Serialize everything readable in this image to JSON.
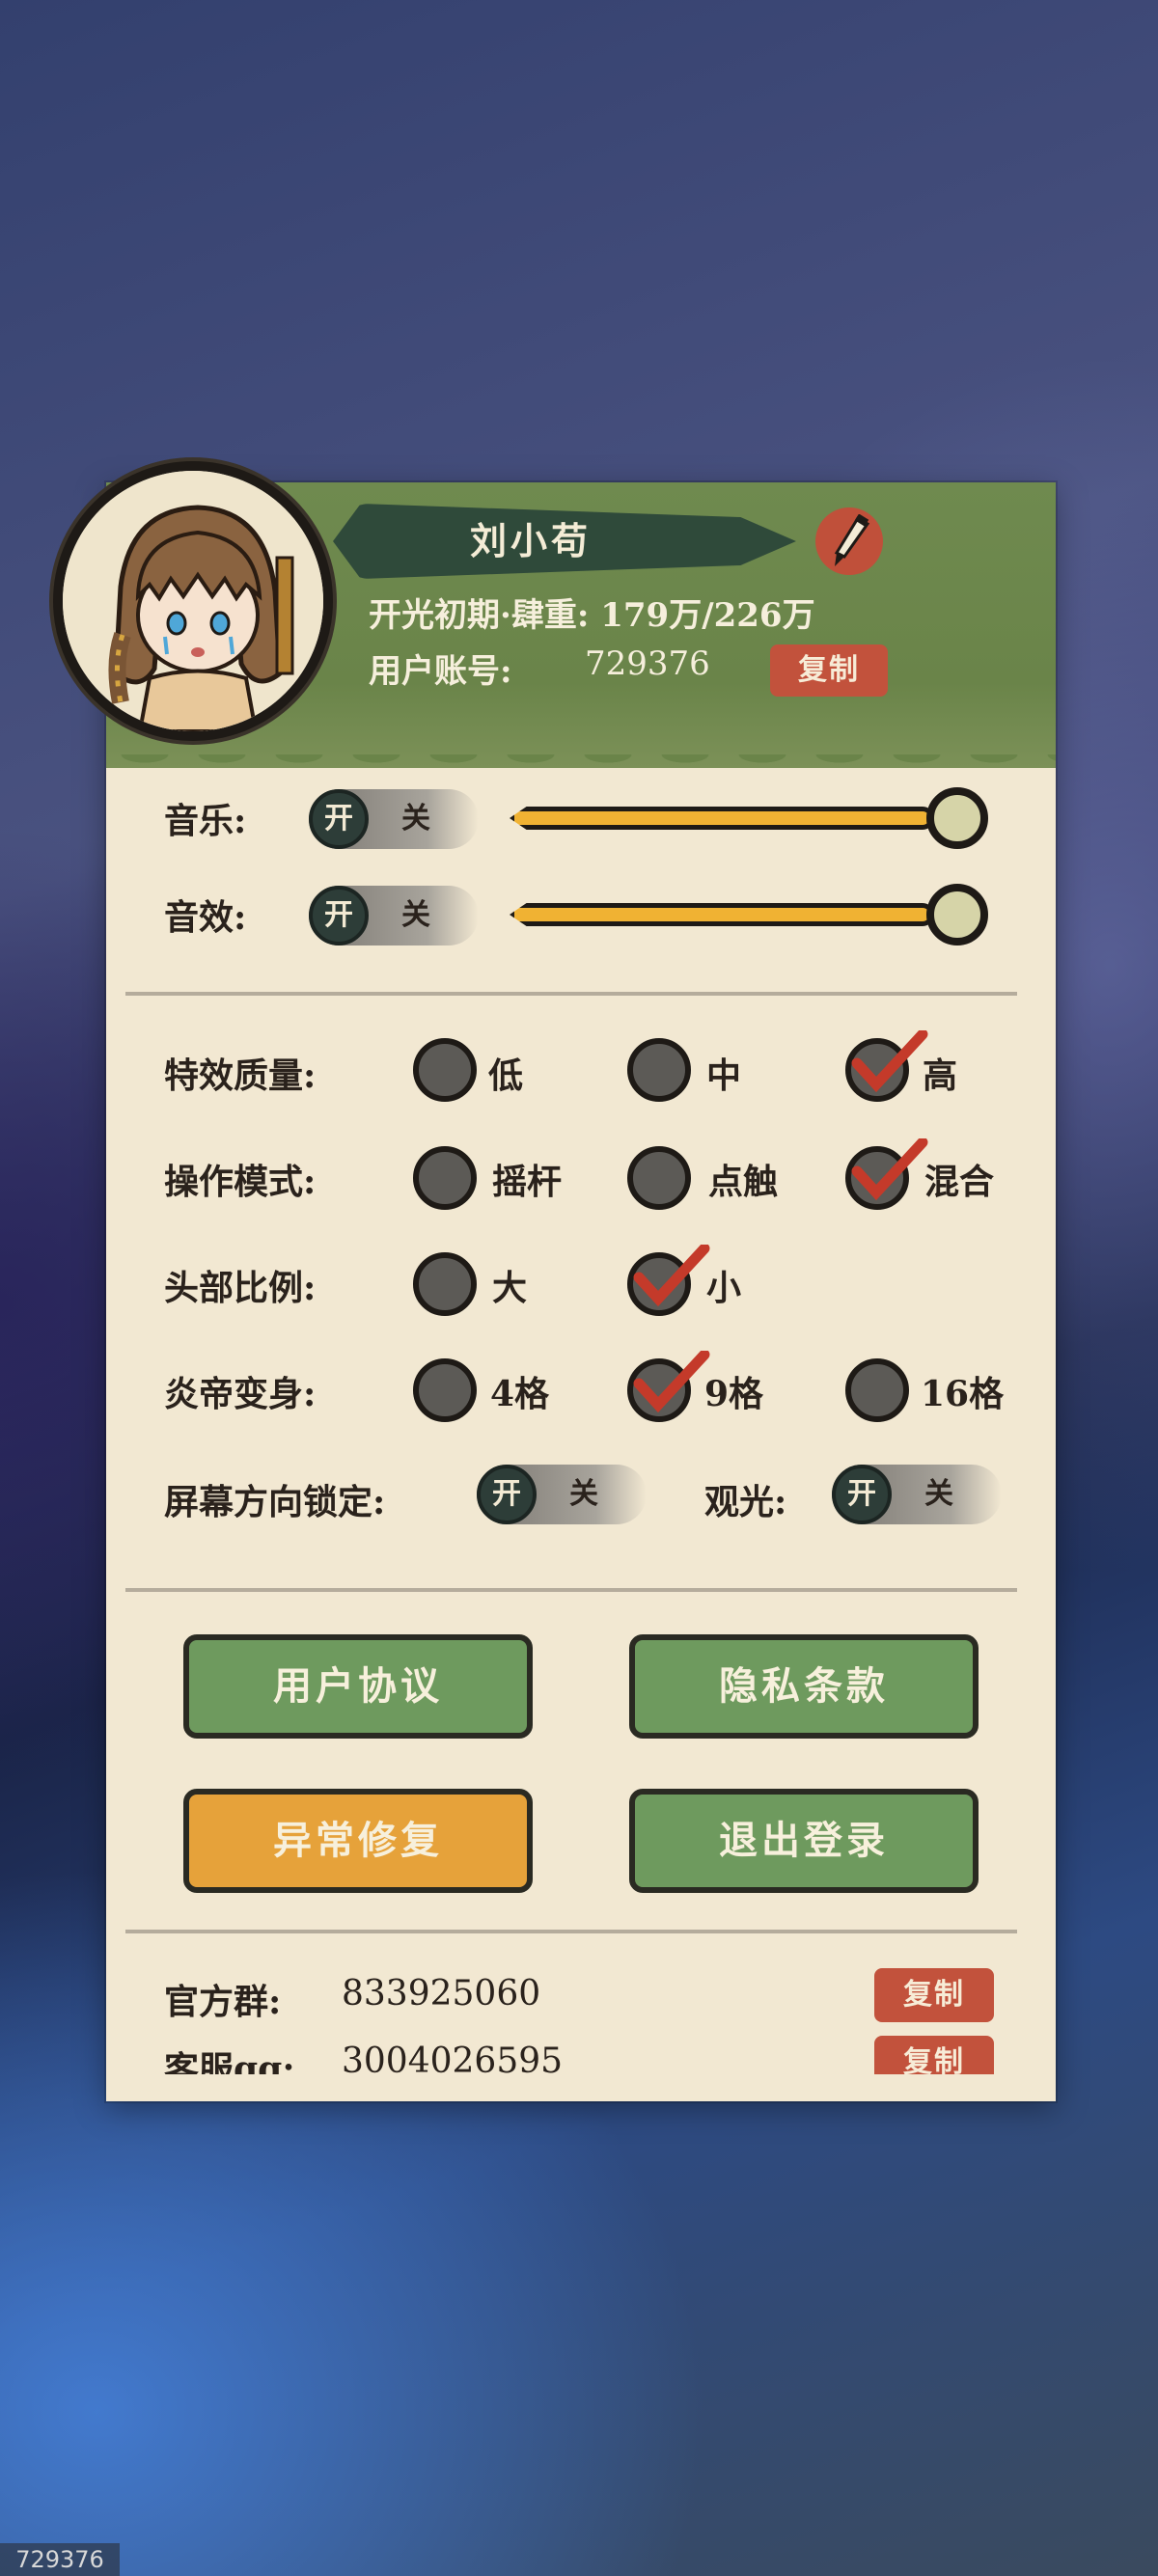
{
  "profile": {
    "name": "刘小苟",
    "realm_line": "开光初期·肆重: 179万/226万",
    "account_label": "用户账号:",
    "account_value": "729376",
    "copy_label": "复制"
  },
  "audio": {
    "music_label": "音乐:",
    "sfx_label": "音效:",
    "on_label": "开",
    "off_label": "关",
    "music_volume": 1.0,
    "sfx_volume": 1.0
  },
  "settings": {
    "effect_quality": {
      "label": "特效质量:",
      "options": [
        "低",
        "中",
        "高"
      ],
      "selected": "高"
    },
    "control_mode": {
      "label": "操作模式:",
      "options": [
        "摇杆",
        "点触",
        "混合"
      ],
      "selected": "混合"
    },
    "head_ratio": {
      "label": "头部比例:",
      "options": [
        "大",
        "小"
      ],
      "selected": "小"
    },
    "transform": {
      "label": "炎帝变身:",
      "options": [
        "4格",
        "9格",
        "16格"
      ],
      "selected": "9格"
    },
    "orientation_lock": {
      "label": "屏幕方向锁定:",
      "on": "开",
      "off": "关"
    },
    "sightseeing": {
      "label": "观光:",
      "on": "开",
      "off": "关"
    }
  },
  "buttons": {
    "user_agreement": "用户协议",
    "privacy": "隐私条款",
    "repair": "异常修复",
    "logout": "退出登录"
  },
  "footer": {
    "group_label": "官方群:",
    "group_value": "833925060",
    "qq_label": "客服qq:",
    "qq_value": "3004026595",
    "copy_label": "复制"
  },
  "watermark": "729376",
  "colors": {
    "header_green": "#6a8449",
    "panel_bg": "#f2e8d2",
    "accent_red": "#c2523c",
    "button_green": "#6e9a5e",
    "button_orange": "#e6a23a",
    "slider_fill": "#f0b233"
  }
}
